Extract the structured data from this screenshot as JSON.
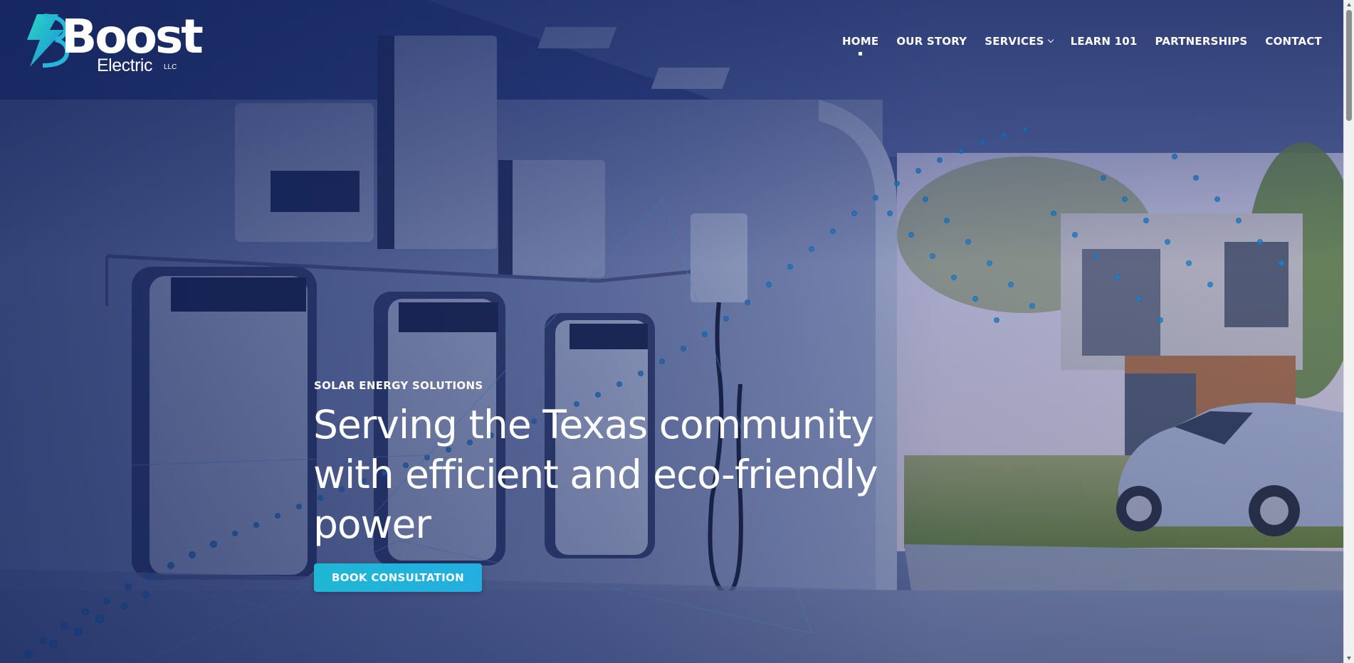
{
  "brand": {
    "name": "Boost",
    "subtitle": "Electric",
    "suffix": "LLC"
  },
  "nav": {
    "items": [
      {
        "label": "HOME",
        "active": true
      },
      {
        "label": "OUR STORY"
      },
      {
        "label": "SERVICES",
        "has_dropdown": true
      },
      {
        "label": "LEARN 101"
      },
      {
        "label": "PARTNERSHIPS"
      },
      {
        "label": "CONTACT"
      }
    ]
  },
  "hero": {
    "eyebrow": "SOLAR ENERGY SOLUTIONS",
    "headline_line1": "Serving the Texas community",
    "headline_line2": "with efficient and eco-friendly",
    "headline_line3": "power",
    "cta_label": "BOOK CONSULTATION"
  },
  "colors": {
    "accent": "#1fb7d3",
    "overlay": "#10225c",
    "text": "#ffffff"
  },
  "icons": [
    "lightning-bolt-icon",
    "chevron-down-icon"
  ]
}
